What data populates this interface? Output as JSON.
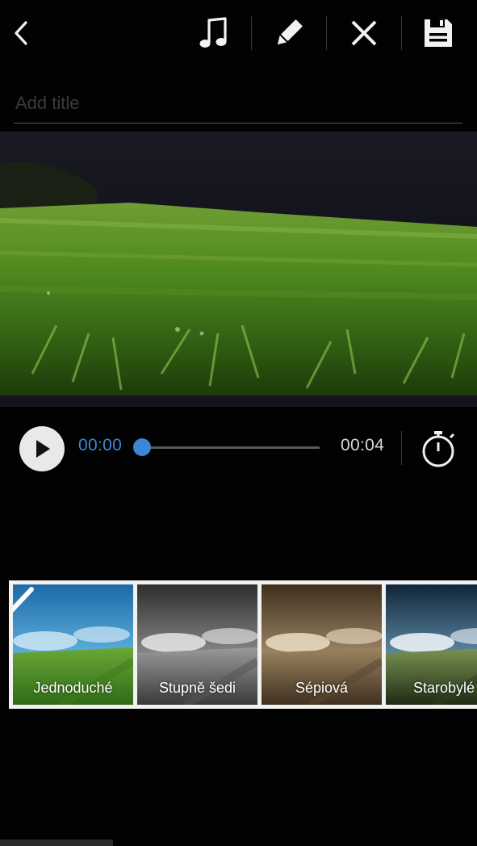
{
  "toolbar": {
    "icons": [
      "back-arrow-icon",
      "music-note-icon",
      "pencil-icon",
      "close-icon",
      "save-icon"
    ]
  },
  "title_field": {
    "placeholder": "Add title",
    "value": ""
  },
  "playback": {
    "current_time": "00:00",
    "total_time": "00:04",
    "progress": 0,
    "icons": [
      "play-icon",
      "timer-icon"
    ]
  },
  "filters": [
    {
      "label": "Jednoduché",
      "selected": true
    },
    {
      "label": "Stupně šedi",
      "selected": false
    },
    {
      "label": "Sépiová",
      "selected": false
    },
    {
      "label": "Starobylé",
      "selected": false
    }
  ],
  "colors": {
    "accent": "#3c86d6",
    "background": "#020202"
  }
}
